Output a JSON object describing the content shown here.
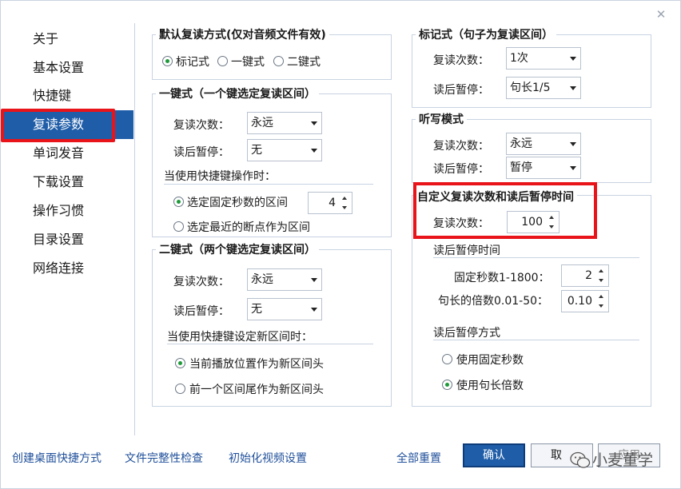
{
  "window": {
    "close_glyph": "✕"
  },
  "sidebar": {
    "items": [
      {
        "label": "关于"
      },
      {
        "label": "基本设置"
      },
      {
        "label": "快捷键"
      },
      {
        "label": "复读参数"
      },
      {
        "label": "单词发音"
      },
      {
        "label": "下载设置"
      },
      {
        "label": "操作习惯"
      },
      {
        "label": "目录设置"
      },
      {
        "label": "网络连接"
      }
    ],
    "active_index": 3
  },
  "default_mode": {
    "title": "默认复读方式(仅对音频文件有效)",
    "options": [
      "标记式",
      "一键式",
      "二键式"
    ],
    "selected": "标记式"
  },
  "one_key": {
    "title": "一键式（一个键选定复读区间）",
    "repeat_label": "复读次数：",
    "repeat_value": "永远",
    "pause_label": "读后暂停：",
    "pause_value": "无",
    "shortcut_heading": "当使用快捷键操作时：",
    "option_fixed": "选定固定秒数的区间",
    "fixed_seconds": "4",
    "option_breakpoint": "选定最近的断点作为区间"
  },
  "two_key": {
    "title": "二键式（两个键选定复读区间）",
    "repeat_label": "复读次数：",
    "repeat_value": "永远",
    "pause_label": "读后暂停：",
    "pause_value": "无",
    "shortcut_heading": "当使用快捷键设定新区间时：",
    "option_current": "当前播放位置作为新区间头",
    "option_prev": "前一个区间尾作为新区间头"
  },
  "marker": {
    "title": "标记式（句子为复读区间）",
    "repeat_label": "复读次数：",
    "repeat_value": "1次",
    "pause_label": "读后暂停：",
    "pause_value": "句长1/5"
  },
  "dictation": {
    "title": "听写模式",
    "repeat_label": "复读次数：",
    "repeat_value": "永远",
    "pause_label": "读后暂停：",
    "pause_value": "暂停"
  },
  "custom": {
    "title": "自定义复读次数和读后暂停时间",
    "repeat_label": "复读次数：",
    "repeat_value": "100",
    "pause_time_heading": "读后暂停时间",
    "fixed_label": "固定秒数1-1800：",
    "fixed_value": "2",
    "multiple_label": "句长的倍数0.01-50：",
    "multiple_value": "0.10",
    "pause_mode_heading": "读后暂停方式",
    "option_fixed": "使用固定秒数",
    "option_multiple": "使用句长倍数"
  },
  "footer": {
    "links": [
      "创建桌面快捷方式",
      "文件完整性检查",
      "初始化视频设置",
      "全部重置"
    ],
    "confirm": "确认",
    "cancel": "取",
    "apply": "应用"
  },
  "watermark": {
    "text": "小麦董学"
  },
  "colors": {
    "accent": "#1f5da8",
    "highlight": "#e8141a",
    "radio_dot": "#1f9a3a"
  }
}
